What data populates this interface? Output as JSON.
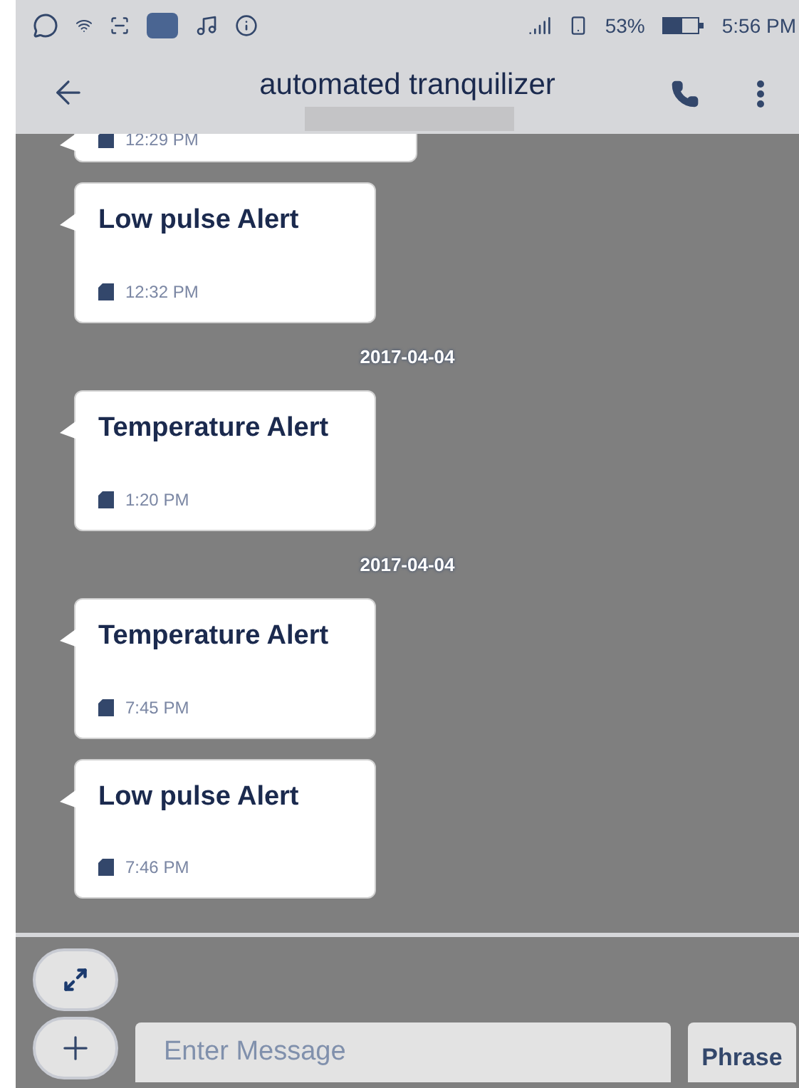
{
  "status_bar": {
    "battery": "53%",
    "time": "5:56 PM"
  },
  "header": {
    "title": "automated tranquilizer"
  },
  "feed": [
    {
      "kind": "message",
      "time": "12:29 PM"
    },
    {
      "kind": "message",
      "text": "Low pulse Alert",
      "time": "12:32 PM"
    },
    {
      "kind": "date",
      "text": "2017-04-04"
    },
    {
      "kind": "message",
      "text": "Temperature Alert",
      "time": "1:20 PM"
    },
    {
      "kind": "date",
      "text": "2017-04-04"
    },
    {
      "kind": "message",
      "text": "Temperature Alert",
      "time": "7:45 PM"
    },
    {
      "kind": "message",
      "text": "Low pulse Alert",
      "time": "7:46 PM"
    }
  ],
  "composer": {
    "placeholder": "Enter Message",
    "phrase_button": "Phrase"
  }
}
